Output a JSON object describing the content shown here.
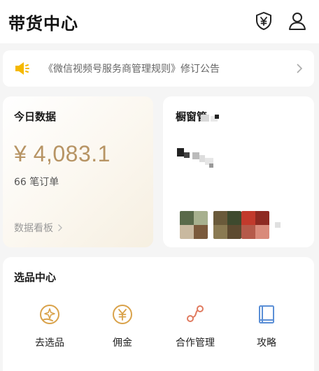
{
  "header": {
    "title": "带货中心",
    "shield_icon": "shield-yen-icon",
    "user_icon": "user-icon"
  },
  "notice": {
    "text": "《微信视频号服务商管理规则》修订公告",
    "icon": "speaker-icon",
    "accent": "#f5b800"
  },
  "today": {
    "label": "今日数据",
    "amount": "¥ 4,083.1",
    "orders": "66 笔订单",
    "board_link": "数据看板",
    "amount_color": "#b79464"
  },
  "window": {
    "label": "橱窗管"
  },
  "picks": {
    "label": "选品中心",
    "items": [
      {
        "label": "去选品",
        "icon": "select-product-icon"
      },
      {
        "label": "佣金",
        "icon": "yen-coin-icon"
      },
      {
        "label": "合作管理",
        "icon": "cooperation-icon"
      },
      {
        "label": "攻略",
        "icon": "guide-book-icon"
      }
    ],
    "icon_colors": {
      "select": "#d9a24a",
      "yen": "#d9a24a",
      "coop": "#e07a5f",
      "guide": "#5b8fd6"
    }
  }
}
